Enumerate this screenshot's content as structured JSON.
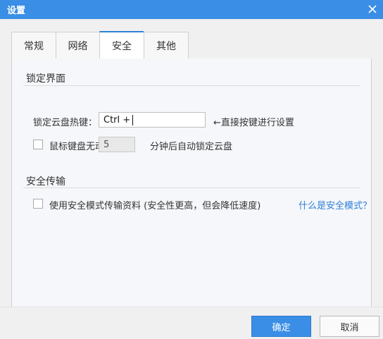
{
  "window": {
    "title": "设置",
    "close_icon": "close-icon"
  },
  "tabs": [
    {
      "label": "常规",
      "active": false
    },
    {
      "label": "网络",
      "active": false
    },
    {
      "label": "安全",
      "active": true
    },
    {
      "label": "其他",
      "active": false
    }
  ],
  "lock_section": {
    "title": "锁定界面",
    "hotkey_label": "锁定云盘热键：",
    "hotkey_value": "Ctrl +",
    "hotkey_hint": "←直接按键进行设置",
    "idle_lock_label": "鼠标键盘无动",
    "idle_lock_checked": false,
    "idle_minutes": "5",
    "idle_suffix": "分钟后自动锁定云盘"
  },
  "secure_section": {
    "title": "安全传输",
    "secure_mode_label": "使用安全模式传输资料 (安全性更高，但会降低速度)",
    "secure_mode_checked": false,
    "help_link": "什么是安全模式？"
  },
  "footer": {
    "ok_label": "确定",
    "cancel_label": "取消"
  },
  "colors": {
    "accent": "#3a8ee6",
    "link": "#2e7fd8"
  }
}
